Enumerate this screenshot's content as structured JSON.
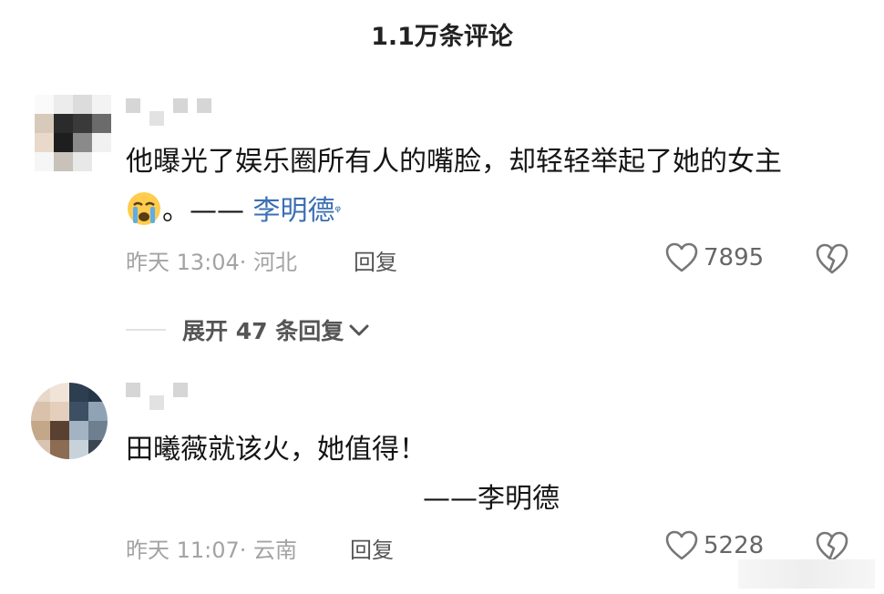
{
  "header": {
    "title": "1.1万条评论"
  },
  "comments": [
    {
      "text_line1": "他曝光了娱乐圈所有人的嘴脸，却轻轻举起了她的女主",
      "text_line2_suffix": "。—— ",
      "mention": "李明德",
      "search_glyph": "ᵠ",
      "time_location": "昨天 13:04· 河北",
      "reply_label": "回复",
      "likes": "7895"
    },
    {
      "text_line1": "田曦薇就该火，她值得！",
      "signature": "——李明德",
      "time_location": "昨天 11:07· 云南",
      "reply_label": "回复",
      "likes": "5228"
    }
  ],
  "expand_replies": {
    "label": "展开 47 条回复"
  },
  "icons": [
    "crying-emoji-icon",
    "search-icon",
    "heart-icon",
    "dislike-heart-icon",
    "chevron-down-icon"
  ],
  "colors": {
    "mention": "#3b6fb3",
    "meta": "#a3a3a3",
    "text": "#151515"
  }
}
